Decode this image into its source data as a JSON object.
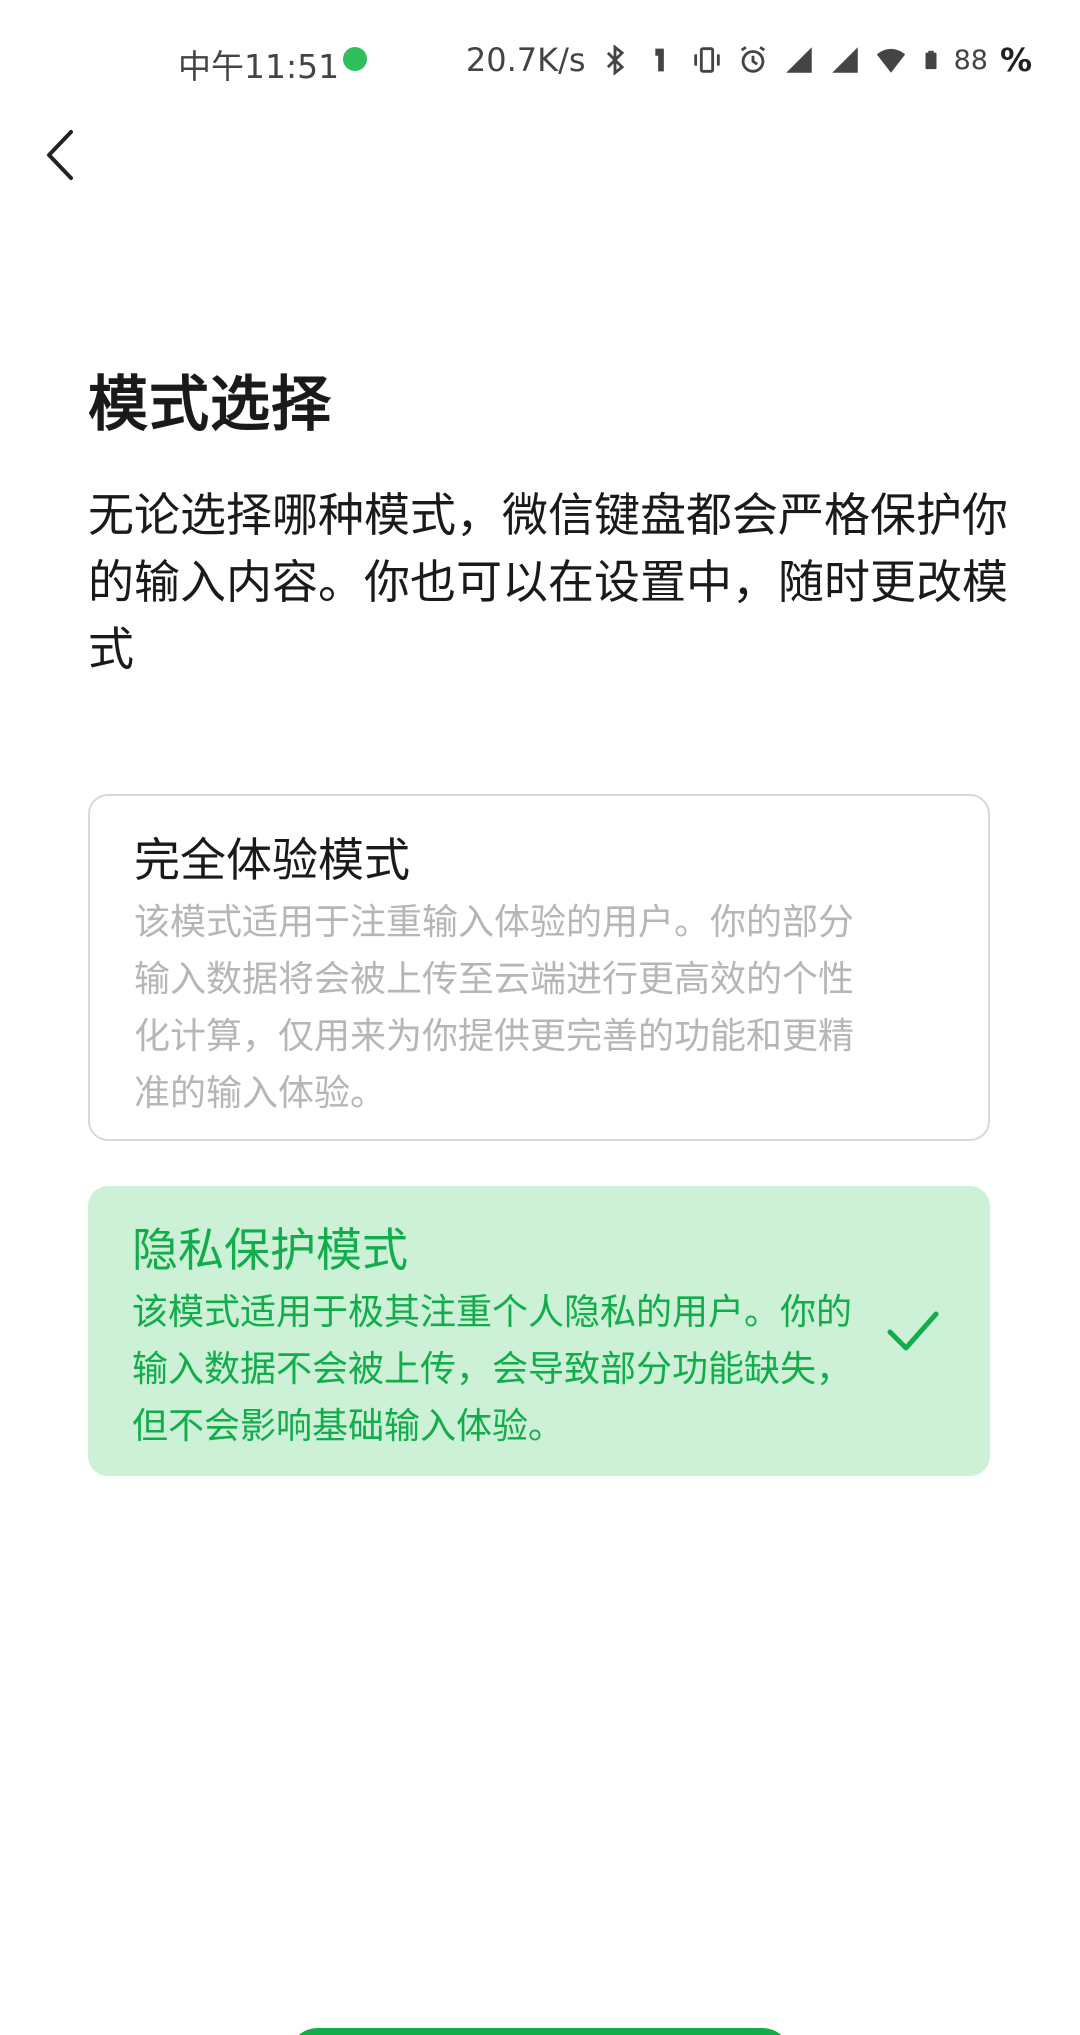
{
  "status_bar": {
    "time": "中午11:51",
    "network_speed": "20.7K/s",
    "battery_level": "88",
    "battery_percent_sign": "%",
    "icons": [
      "wechat-dot-icon",
      "bluetooth-icon",
      "nfc-icon",
      "vibrate-icon",
      "alarm-icon",
      "hd-signal-icon",
      "signal-icon",
      "wifi-icon",
      "battery-icon"
    ]
  },
  "header": {
    "back_icon": "chevron-left-icon"
  },
  "page": {
    "title": "模式选择",
    "description": "无论选择哪种模式，微信键盘都会严格保护你的输入内容。你也可以在设置中，随时更改模式"
  },
  "modes": [
    {
      "title": "完全体验模式",
      "description": "该模式适用于注重输入体验的用户。你的部分输入数据将会被上传至云端进行更高效的个性化计算，仅用来为你提供更完善的功能和更精准的输入体验。",
      "selected": false
    },
    {
      "title": "隐私保护模式",
      "description": "该模式适用于极其注重个人隐私的用户。你的输入数据不会被上传，会导致部分功能缺失，但不会影响基础输入体验。",
      "selected": true
    }
  ],
  "colors": {
    "accent": "#12ad4b",
    "selected_card_bg": "#ccf1d7",
    "unselected_desc": "#b6b6b6",
    "card_border": "#d8d8d8"
  }
}
